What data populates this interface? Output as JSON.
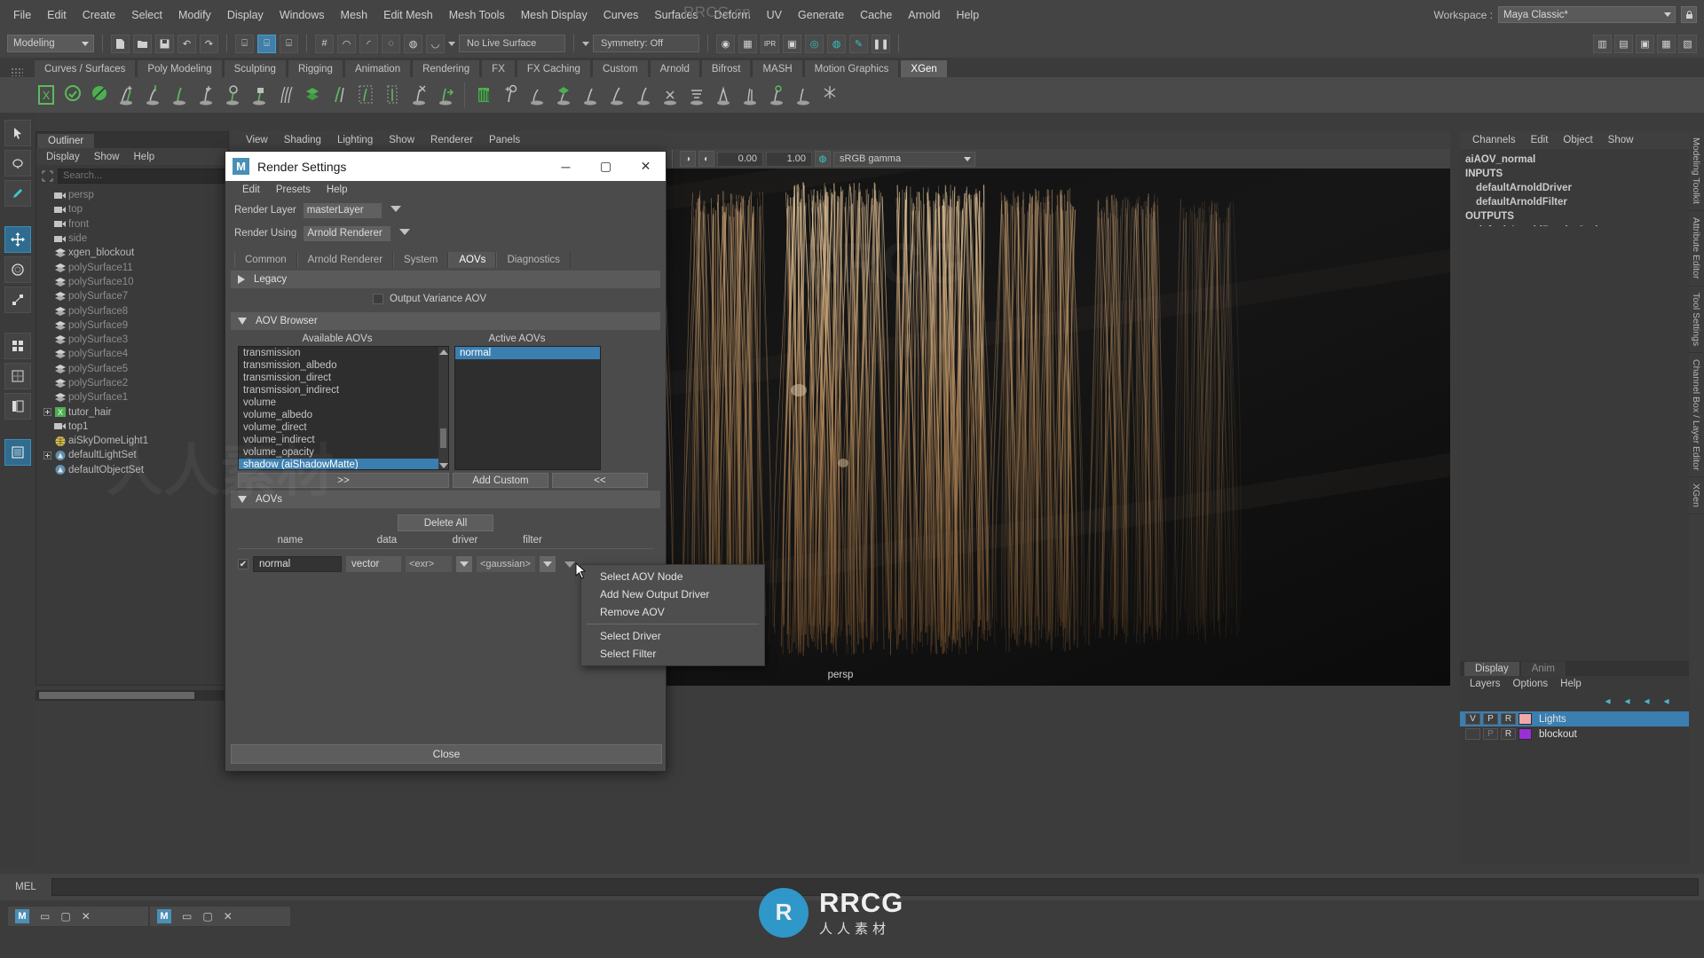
{
  "app": {
    "watermark_top": "RRCG.cn",
    "watermark_main": "RRCG",
    "watermark_sub": "人人素材",
    "watermark_mark": "R"
  },
  "menubar": {
    "items": [
      "File",
      "Edit",
      "Create",
      "Select",
      "Modify",
      "Display",
      "Windows",
      "Mesh",
      "Edit Mesh",
      "Mesh Tools",
      "Mesh Display",
      "Curves",
      "Surfaces",
      "Deform",
      "UV",
      "Generate",
      "Cache",
      "Arnold",
      "Help"
    ],
    "workspace_label": "Workspace :",
    "workspace_value": "Maya Classic*",
    "lock_icon": "lock-icon"
  },
  "statusbar": {
    "mode": "Modeling",
    "live_surface": "No Live Surface",
    "symmetry": "Symmetry: Off"
  },
  "shelf": {
    "tabs": [
      "Curves / Surfaces",
      "Poly Modeling",
      "Sculpting",
      "Rigging",
      "Animation",
      "Rendering",
      "FX",
      "FX Caching",
      "Custom",
      "Arnold",
      "Bifrost",
      "MASH",
      "Motion Graphics",
      "XGen"
    ],
    "active_tab": "XGen"
  },
  "outliner": {
    "tab": "Outliner",
    "menu": [
      "Display",
      "Show",
      "Help"
    ],
    "search_placeholder": "Search...",
    "items": [
      {
        "label": "persp",
        "icon": "camera-icon",
        "dim": true,
        "expand": ""
      },
      {
        "label": "top",
        "icon": "camera-icon",
        "dim": true,
        "expand": ""
      },
      {
        "label": "front",
        "icon": "camera-icon",
        "dim": true,
        "expand": ""
      },
      {
        "label": "side",
        "icon": "camera-icon",
        "dim": true,
        "expand": ""
      },
      {
        "label": "xgen_blockout",
        "icon": "mesh-icon",
        "dim": false,
        "expand": ""
      },
      {
        "label": "polySurface11",
        "icon": "mesh-icon",
        "dim": true,
        "expand": ""
      },
      {
        "label": "polySurface10",
        "icon": "mesh-icon",
        "dim": true,
        "expand": ""
      },
      {
        "label": "polySurface7",
        "icon": "mesh-icon",
        "dim": true,
        "expand": ""
      },
      {
        "label": "polySurface8",
        "icon": "mesh-icon",
        "dim": true,
        "expand": ""
      },
      {
        "label": "polySurface9",
        "icon": "mesh-icon",
        "dim": true,
        "expand": ""
      },
      {
        "label": "polySurface3",
        "icon": "mesh-icon",
        "dim": true,
        "expand": ""
      },
      {
        "label": "polySurface4",
        "icon": "mesh-icon",
        "dim": true,
        "expand": ""
      },
      {
        "label": "polySurface5",
        "icon": "mesh-icon",
        "dim": true,
        "expand": ""
      },
      {
        "label": "polySurface2",
        "icon": "mesh-icon",
        "dim": true,
        "expand": ""
      },
      {
        "label": "polySurface1",
        "icon": "mesh-icon",
        "dim": true,
        "expand": ""
      },
      {
        "label": "tutor_hair",
        "icon": "xgen-icon",
        "dim": false,
        "expand": "+"
      },
      {
        "label": "top1",
        "icon": "camera-icon",
        "dim": false,
        "expand": ""
      },
      {
        "label": "aiSkyDomeLight1",
        "icon": "skydome-icon",
        "dim": false,
        "expand": ""
      },
      {
        "label": "defaultLightSet",
        "icon": "set-icon",
        "dim": false,
        "expand": "+"
      },
      {
        "label": "defaultObjectSet",
        "icon": "set-icon",
        "dim": false,
        "expand": ""
      }
    ]
  },
  "viewport": {
    "menu": [
      "View",
      "Shading",
      "Lighting",
      "Show",
      "Renderer",
      "Panels"
    ],
    "near_clip": "0.00",
    "far_clip": "1.00",
    "gamma": "sRGB gamma",
    "camera_label": "persp"
  },
  "channel_box": {
    "menu": [
      "Channels",
      "Edit",
      "Object",
      "Show"
    ],
    "node": "aiAOV_normal",
    "inputs_label": "INPUTS",
    "inputs": [
      "defaultArnoldDriver",
      "defaultArnoldFilter"
    ],
    "outputs_label": "OUTPUTS",
    "outputs": [
      "defaultArnoldRenderOptions"
    ],
    "vertical_tabs": [
      "Modeling Toolkit",
      "Attribute Editor",
      "Tool Settings",
      "Channel Box / Layer Editor",
      "XGen"
    ]
  },
  "layer_editor": {
    "tabs": [
      "Display",
      "Anim"
    ],
    "active_tab": "Display",
    "menu": [
      "Layers",
      "Options",
      "Help"
    ],
    "rows": [
      {
        "v": "V",
        "p": "P",
        "r": "R",
        "color": "#f0a8a8",
        "name": "Lights",
        "selected": true
      },
      {
        "v": "",
        "p": "P",
        "r": "R",
        "color": "#9b2fd6",
        "name": "blockout",
        "selected": false
      }
    ]
  },
  "bottom": {
    "mel_label": "MEL",
    "taskbar_items": [
      "Maya",
      "Maya"
    ]
  },
  "render_settings": {
    "title": "Render Settings",
    "menu": [
      "Edit",
      "Presets",
      "Help"
    ],
    "render_layer_label": "Render Layer",
    "render_layer_value": "masterLayer",
    "render_using_label": "Render Using",
    "render_using_value": "Arnold Renderer",
    "tabs": [
      "Common",
      "Arnold Renderer",
      "System",
      "AOVs",
      "Diagnostics"
    ],
    "active_tab": "AOVs",
    "legacy_label": "Legacy",
    "output_variance_label": "Output Variance AOV",
    "output_variance_checked": false,
    "aov_browser_label": "AOV Browser",
    "available_header": "Available AOVs",
    "active_header": "Active AOVs",
    "available_items": [
      "transmission",
      "transmission_albedo",
      "transmission_direct",
      "transmission_indirect",
      "volume",
      "volume_albedo",
      "volume_direct",
      "volume_indirect",
      "volume_opacity",
      "shadow (aiShadowMatte)"
    ],
    "available_selected": "shadow (aiShadowMatte)",
    "active_items": [
      "normal"
    ],
    "active_selected": "normal",
    "btn_add": ">>",
    "btn_add_custom": "Add Custom",
    "btn_remove": "<<",
    "aovs_section_label": "AOVs",
    "delete_all_label": "Delete All",
    "table_headers": [
      "name",
      "data",
      "driver",
      "filter"
    ],
    "table_rows": [
      {
        "enabled": true,
        "name": "normal",
        "data": "vector",
        "driver": "<exr>",
        "filter": "<gaussian>"
      }
    ],
    "close_label": "Close",
    "window_buttons": [
      "minimize",
      "maximize",
      "close"
    ]
  },
  "context_menu": {
    "items": [
      {
        "label": "Select AOV Node",
        "divider_after": false
      },
      {
        "label": "Add New Output Driver",
        "divider_after": false
      },
      {
        "label": "Remove AOV",
        "divider_after": true
      },
      {
        "label": "Select Driver",
        "divider_after": false
      },
      {
        "label": "Select Filter",
        "divider_after": false
      }
    ]
  },
  "colors": {
    "accent_blue": "#3a7fb0",
    "teal": "#3ec9c9",
    "xgen_green": "#4caf50",
    "bg_dark": "#3c3c3c"
  }
}
